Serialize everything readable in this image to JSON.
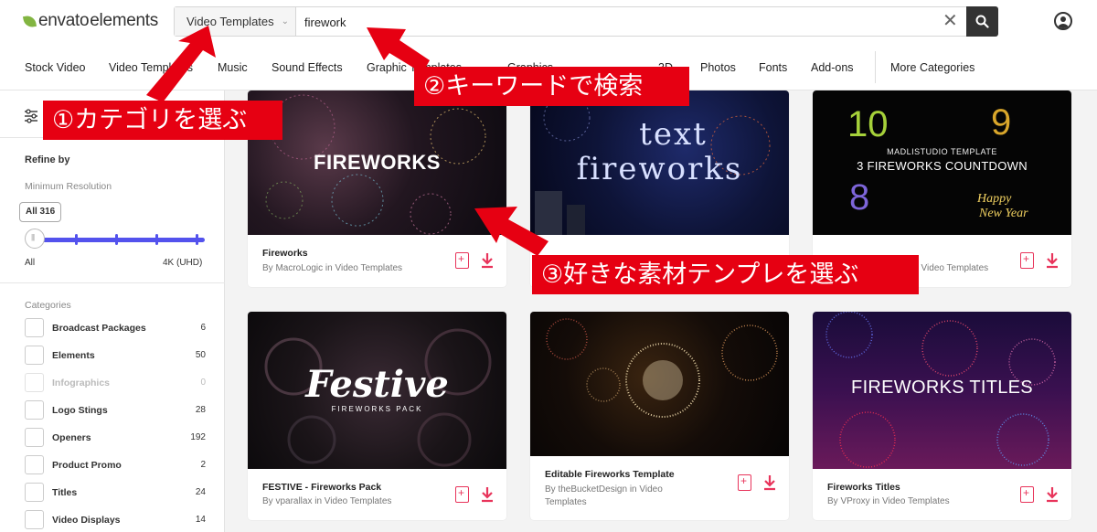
{
  "header": {
    "logo_part1": "envato",
    "logo_part2": "elements",
    "category_select": "Video Templates",
    "search_value": "firework"
  },
  "nav": {
    "items": [
      "Stock Video",
      "Video Templates",
      "Music",
      "Sound Effects",
      "Graphic Templates",
      "Graphics",
      "3D",
      "Photos",
      "Fonts",
      "Add-ons"
    ],
    "more": "More Categories"
  },
  "sidebar": {
    "refine_by": "Refine by",
    "min_resolution": "Minimum Resolution",
    "tooltip": "All 316",
    "slider_min": "All",
    "slider_max": "4K (UHD)",
    "slider_level": 0,
    "categories_heading": "Categories",
    "categories": [
      {
        "label": "Broadcast Packages",
        "count": "6"
      },
      {
        "label": "Elements",
        "count": "50"
      },
      {
        "label": "Infographics",
        "count": "0"
      },
      {
        "label": "Logo Stings",
        "count": "28"
      },
      {
        "label": "Openers",
        "count": "192"
      },
      {
        "label": "Product Promo",
        "count": "2"
      },
      {
        "label": "Titles",
        "count": "24"
      },
      {
        "label": "Video Displays",
        "count": "14"
      }
    ]
  },
  "cards": [
    {
      "thumb_text": "FIREWORKS",
      "title": "Fireworks",
      "author": "By MacroLogic in Video Templates"
    },
    {
      "thumb_text1": "text",
      "thumb_text2": "fireworks",
      "title": "",
      "author": ""
    },
    {
      "thumb_text1": "MADLISTUDIO TEMPLATE",
      "thumb_text2": "3 FIREWORKS COUNTDOWN",
      "title": "",
      "author": "in Video Templates"
    },
    {
      "thumb_text1": "Festive",
      "thumb_text2": "FIREWORKS PACK",
      "title": "FESTIVE - Fireworks Pack",
      "author": "By vparallax in Video Templates"
    },
    {
      "title": "Editable Fireworks Template",
      "author": "By theBucketDesign in Video Templates"
    },
    {
      "thumb_text": "FIREWORKS TITLES",
      "title": "Fireworks Titles",
      "author": "By VProxy in Video Templates"
    }
  ],
  "callouts": {
    "step1": "①カテゴリを選ぶ",
    "step2": "②キーワードで検索",
    "step3": "③好きな素材テンプレを選ぶ"
  },
  "colors": {
    "accent": "#5352ed",
    "callout": "#e60012",
    "icon_red": "#e8345b",
    "logo_green": "#82b541"
  }
}
